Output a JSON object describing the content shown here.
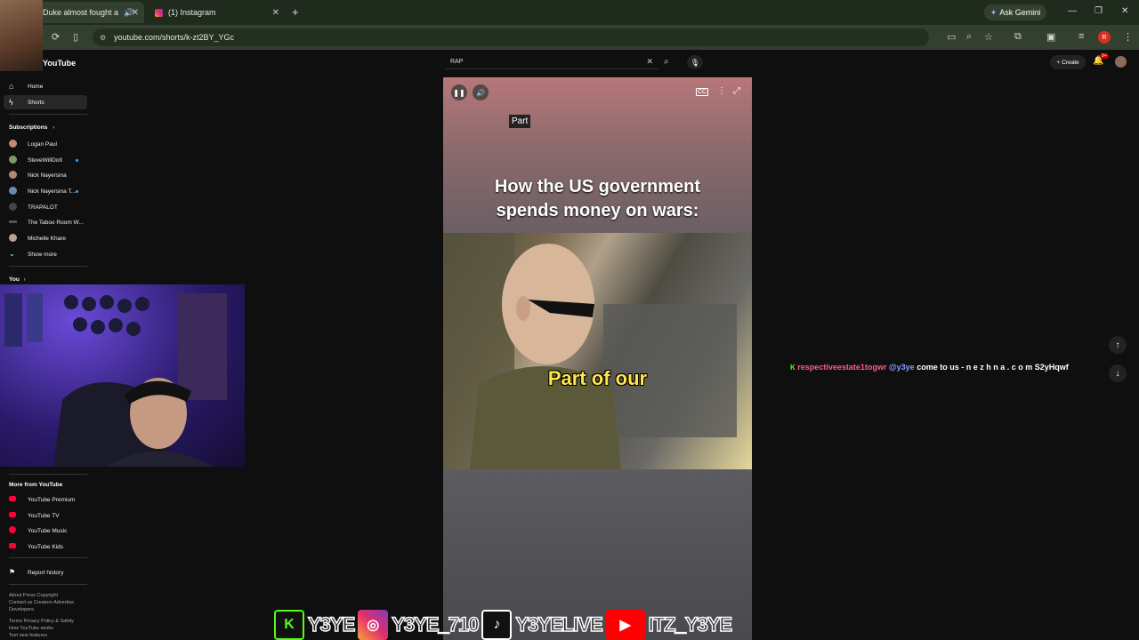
{
  "browser": {
    "tabs": [
      {
        "label": "Duke almost fought a",
        "active": true
      },
      {
        "label": "(1) Instagram",
        "active": false
      }
    ],
    "new_tab": "+",
    "ask_gemini": "Ask Gemini",
    "url": "youtube.com/shorts/k-zt2BY_YGc",
    "profile_initial": "R"
  },
  "youtube": {
    "logo": "YouTube",
    "search_value": "RAP",
    "create_label": "Create",
    "notif_count": "9+",
    "sidebar": {
      "home": "Home",
      "shorts": "Shorts",
      "subscriptions_header": "Subscriptions",
      "subscriptions": [
        {
          "name": "Logan Paul",
          "dot": false,
          "color": "#c48a6a"
        },
        {
          "name": "SteveWillDoIt",
          "dot": true,
          "color": "#7a9a6a"
        },
        {
          "name": "Nick Nayersina",
          "dot": false,
          "color": "#b08a70"
        },
        {
          "name": "Nick Nayersina T...",
          "dot": true,
          "color": "#6a8ab0"
        },
        {
          "name": "TRAPALOT",
          "dot": false,
          "color": "#444444"
        },
        {
          "name": "The Taboo Room W...",
          "dot": false,
          "color": "#555555"
        },
        {
          "name": "Michelle Khare",
          "dot": false,
          "color": "#c0a08a"
        }
      ],
      "show_more": "Show more",
      "you_header": "You",
      "more_header": "More from YouTube",
      "more_items": [
        "YouTube Premium",
        "YouTube TV",
        "YouTube Music",
        "YouTube Kids"
      ],
      "report_history": "Report history",
      "footer1": "About  Press  Copyright",
      "footer2": "Contact us  Creators  Advertise",
      "footer3": "Developers",
      "footer4": "Terms  Privacy  Policy & Safety",
      "footer5": "How YouTube works",
      "footer6": "Test new features"
    },
    "player": {
      "part_label": "Part",
      "headline_line1": "How the US government",
      "headline_line2": "spends money on wars:",
      "caption": "Part of our"
    }
  },
  "chat": {
    "username": "respectiveestate1togwr",
    "mention": "@y3ye",
    "message": "come to us - n e z h n a . c o m S2yHqwf",
    "username_color": "#ff5c8a",
    "mention_color": "#8a9aff"
  },
  "overlay": {
    "kick": "Y3YE",
    "instagram": "Y3YE_710",
    "tiktok": "Y3YELIVE",
    "youtube": "ITZ_Y3YE"
  }
}
